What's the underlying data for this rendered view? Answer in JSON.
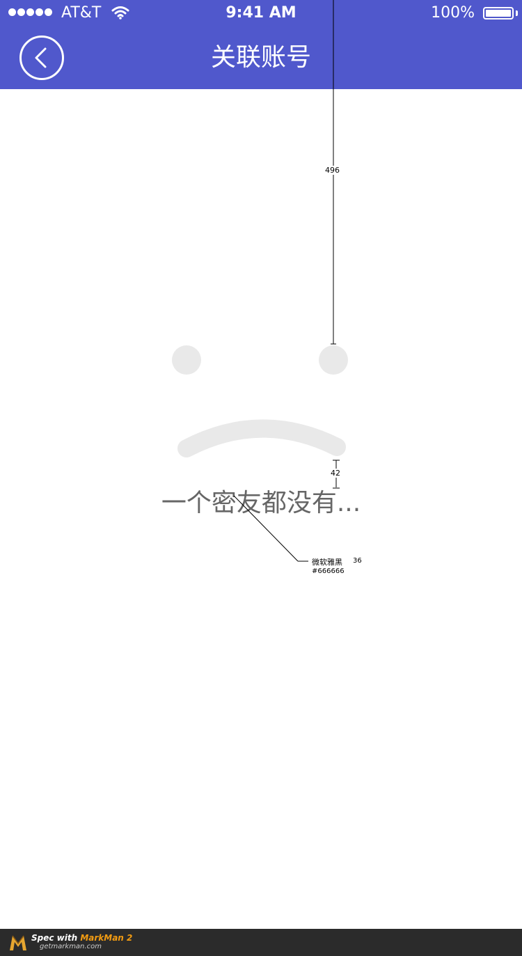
{
  "status_bar": {
    "carrier": "AT&T",
    "time": "9:41 AM",
    "battery": "100%"
  },
  "header": {
    "title": "关联账号",
    "back_icon": "chevron-left-icon"
  },
  "empty_state": {
    "icon": "sad-face-icon",
    "message": "一个密友都没有..."
  },
  "spec_annotations": {
    "top_distance": "496",
    "gap_distance": "42",
    "font_name": "微软雅黑",
    "font_size": "36",
    "font_color": "#666666"
  },
  "footer": {
    "spec_with": "Spec with",
    "brand": "MarkMan 2",
    "url": "getmarkman.com"
  },
  "colors": {
    "header_bg": "#5058cc",
    "face": "#e9e9e9",
    "text": "#666666"
  }
}
